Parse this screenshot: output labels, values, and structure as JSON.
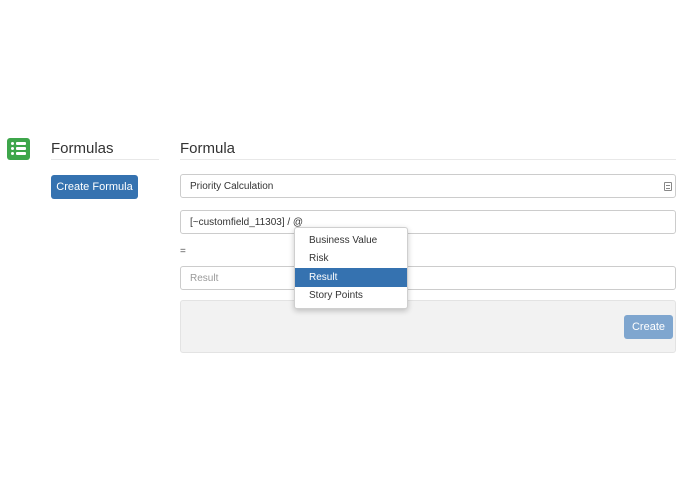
{
  "sidebar": {
    "logo_icon": "formula-grid-icon",
    "title": "Formulas",
    "create_button_label": "Create Formula"
  },
  "main": {
    "title": "Formula",
    "name_field": {
      "value": "Priority Calculation",
      "icon": "list-icon"
    },
    "expression_field": {
      "value": "[~customfield_11303] / @"
    },
    "equals_label": "=",
    "result_field": {
      "placeholder": "Result"
    },
    "create_button_label": "Create"
  },
  "autocomplete": {
    "items": [
      {
        "label": "Business Value",
        "active": false
      },
      {
        "label": "Risk",
        "active": false
      },
      {
        "label": "Result",
        "active": true
      },
      {
        "label": "Story Points",
        "active": false
      }
    ]
  },
  "colors": {
    "accent": "#3572b0",
    "accent_disabled": "#7fa6cf",
    "logo_green": "#3ea64b",
    "panel_bg": "#f2f2f2"
  }
}
